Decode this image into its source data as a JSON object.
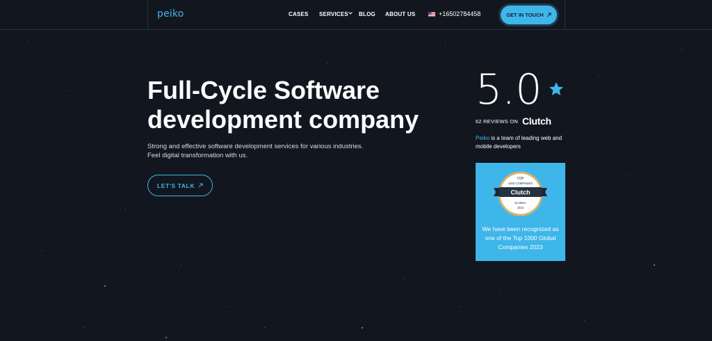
{
  "header": {
    "logo": "peiko",
    "nav": [
      {
        "label": "CASES"
      },
      {
        "label": "SERVICES"
      },
      {
        "label": "BLOG"
      },
      {
        "label": "ABOUT US"
      }
    ],
    "phone": "+16502784458",
    "cta_label": "GET IN TOUCH"
  },
  "hero": {
    "title_line1": "Full-Cycle Software",
    "title_line2": "development company",
    "subtitle_line1": "Strong and effective software development services for various industries.",
    "subtitle_line2": "Feel digital transformation with us.",
    "button_label": "LET'S TALK"
  },
  "rating": {
    "score": "5.0",
    "reviews": "62 REVIEWS ON",
    "platform": "Clutch",
    "team_brand": "Peiko",
    "team_text": " is a team of leading web and mobile developers"
  },
  "badge_card": {
    "badge_top": "TOP",
    "badge_sub": "1000 COMPANIES",
    "badge_brand": "Clutch",
    "badge_scope": "GLOBAL",
    "badge_year": "2023",
    "text": "We have been recognized as one of the Top 1000 Global Companies 2023"
  },
  "colors": {
    "background": "#12171f",
    "accent": "#3fb6ea",
    "text": "#ffffff"
  },
  "icons": [
    "chevron-down-icon",
    "us-flag-icon",
    "arrow-up-right-icon",
    "star-icon"
  ]
}
